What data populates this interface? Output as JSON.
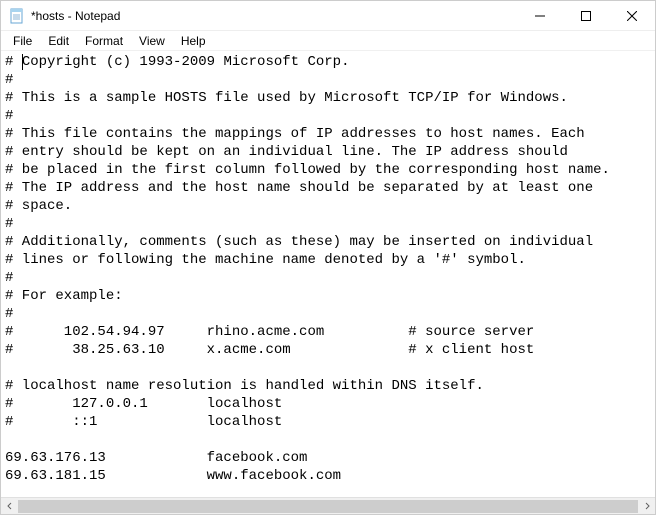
{
  "window": {
    "title": "*hosts - Notepad"
  },
  "menu": {
    "file": "File",
    "edit": "Edit",
    "format": "Format",
    "view": "View",
    "help": "Help"
  },
  "content": {
    "lines": [
      "# Copyright (c) 1993-2009 Microsoft Corp.",
      "#",
      "# This is a sample HOSTS file used by Microsoft TCP/IP for Windows.",
      "#",
      "# This file contains the mappings of IP addresses to host names. Each",
      "# entry should be kept on an individual line. The IP address should",
      "# be placed in the first column followed by the corresponding host name.",
      "# The IP address and the host name should be separated by at least one",
      "# space.",
      "#",
      "# Additionally, comments (such as these) may be inserted on individual",
      "# lines or following the machine name denoted by a '#' symbol.",
      "#",
      "# For example:",
      "#",
      "#      102.54.94.97     rhino.acme.com          # source server",
      "#       38.25.63.10     x.acme.com              # x client host",
      "",
      "# localhost name resolution is handled within DNS itself.",
      "#       127.0.0.1       localhost",
      "#       ::1             localhost",
      "",
      "69.63.176.13            facebook.com",
      "69.63.181.15            www.facebook.com"
    ]
  }
}
